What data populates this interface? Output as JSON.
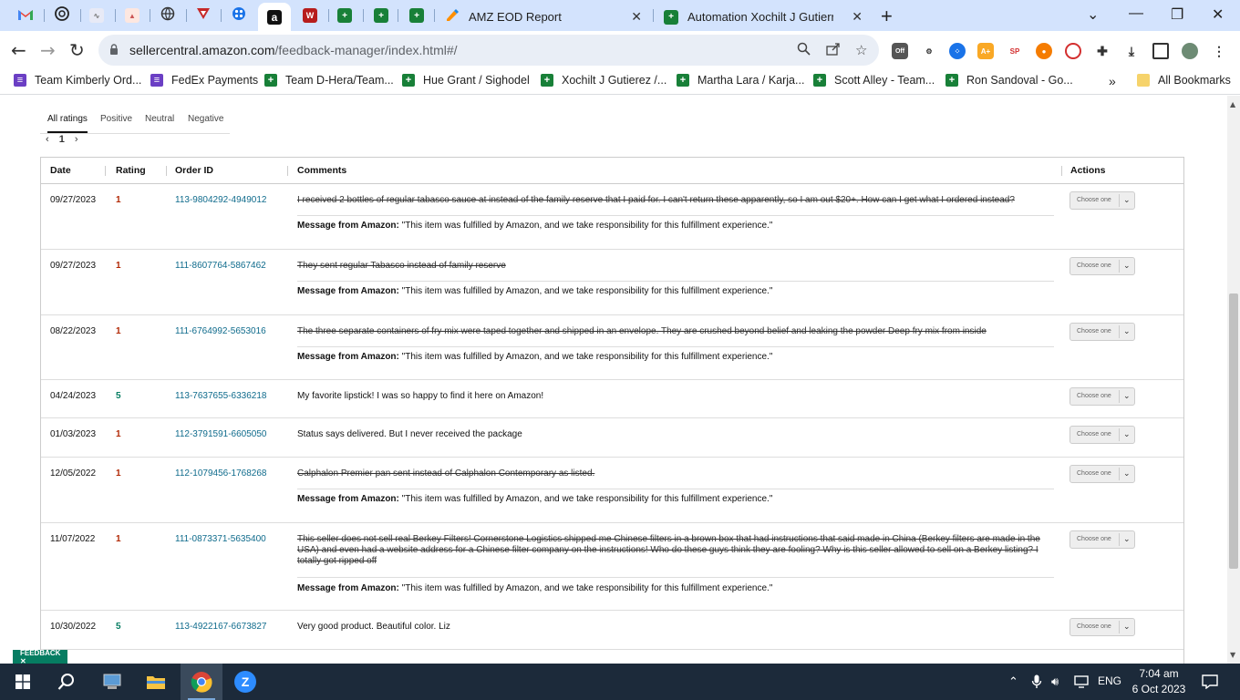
{
  "browser": {
    "tabs": [
      {
        "label": "AMZ EOD Report",
        "icon": "form-icon"
      },
      {
        "label": "Automation Xochilt J Gutierrez (",
        "icon": "sheets-icon"
      }
    ],
    "pinned_icons": [
      "gmail-icon",
      "openai-icon",
      "tool-icon",
      "tool-icon",
      "globe-icon",
      "v-icon",
      "grid-icon",
      "amazon-icon",
      "w-icon",
      "sheets-icon",
      "sheets-icon",
      "sheets-icon"
    ],
    "url_host": "sellercentral.amazon.com",
    "url_path": "/feedback-manager/index.html#/",
    "ext_off_badge": "Off",
    "bookmarks": [
      {
        "label": "Team Kimberly Ord...",
        "icon": "forms-icon"
      },
      {
        "label": "FedEx Payments",
        "icon": "forms-icon"
      },
      {
        "label": "Team D-Hera/Team...",
        "icon": "sheets-icon"
      },
      {
        "label": "Hue Grant / Sighodel",
        "icon": "sheets-icon"
      },
      {
        "label": "Xochilt J Gutierez /...",
        "icon": "sheets-icon"
      },
      {
        "label": "Martha Lara / Karja...",
        "icon": "sheets-icon"
      },
      {
        "label": "Scott Alley - Team...",
        "icon": "sheets-icon"
      },
      {
        "label": "Ron Sandoval - Go...",
        "icon": "sheets-icon"
      }
    ],
    "more_bookmarks": "»",
    "all_bookmarks": "All Bookmarks"
  },
  "feedback": {
    "filter_tabs": [
      "All ratings",
      "Positive",
      "Neutral",
      "Negative"
    ],
    "page_number": "1",
    "columns": [
      "Date",
      "Rating",
      "Order ID",
      "Comments",
      "Actions"
    ],
    "action_placeholder": "Choose one",
    "amazon_msg_label": "Message from Amazon:",
    "amazon_msg_text": "\"This item was fulfilled by Amazon, and we take responsibility for this fulfillment experience.\"",
    "rows": [
      {
        "date": "09/27/2023",
        "rating": "1",
        "order_id": "113-9804292-4949012",
        "comment": "I received 2 bottles of regular tabasco sauce at instead of the family reserve that I paid for. I can't return these apparently, so I am out $20+. How can I get what I ordered instead?",
        "struck": true
      },
      {
        "date": "09/27/2023",
        "rating": "1",
        "order_id": "111-8607764-5867462",
        "comment": "They sent regular Tabasco instead of family reserve",
        "struck": true
      },
      {
        "date": "08/22/2023",
        "rating": "1",
        "order_id": "111-6764992-5653016",
        "comment": "The three separate containers of fry mix were taped together and shipped in an envelope. They are crushed beyond belief and leaking the powder Deep fry mix from inside",
        "struck": true
      },
      {
        "date": "04/24/2023",
        "rating": "5",
        "order_id": "113-7637655-6336218",
        "comment": "My favorite lipstick! I was so happy to find it here on Amazon!",
        "struck": false
      },
      {
        "date": "01/03/2023",
        "rating": "1",
        "order_id": "112-3791591-6605050",
        "comment": "Status says delivered. But I never received the package",
        "struck": false
      },
      {
        "date": "12/05/2022",
        "rating": "1",
        "order_id": "112-1079456-1768268",
        "comment": "Calphalon Premier pan sent instead of Calphalon Contemporary as listed.",
        "struck": true
      },
      {
        "date": "11/07/2022",
        "rating": "1",
        "order_id": "111-0873371-5635400",
        "comment": "This seller does not sell real Berkey Filters! Cornerstone Logistics shipped me Chinese filters in a brown box that had instructions that said made in China (Berkey filters are made in the USA) and even had a website address for a Chinese filter company on the instructions! Who do these guys think they are fooling? Why is this seller allowed to sell on a Berkey listing? I totally got ripped off",
        "struck": true
      },
      {
        "date": "10/30/2022",
        "rating": "5",
        "order_id": "113-4922167-6673827",
        "comment": "Very good product. Beautiful color. Liz",
        "struck": false
      }
    ],
    "feedback_tab": "FEEDBACK ✕"
  },
  "taskbar": {
    "language": "ENG",
    "time": "7:04 am",
    "date": "6 Oct 2023"
  },
  "colors": {
    "tabstrip": "#d3e3fd",
    "negative": "#b12704",
    "positive": "#067d62",
    "link": "#0f6b8c"
  }
}
